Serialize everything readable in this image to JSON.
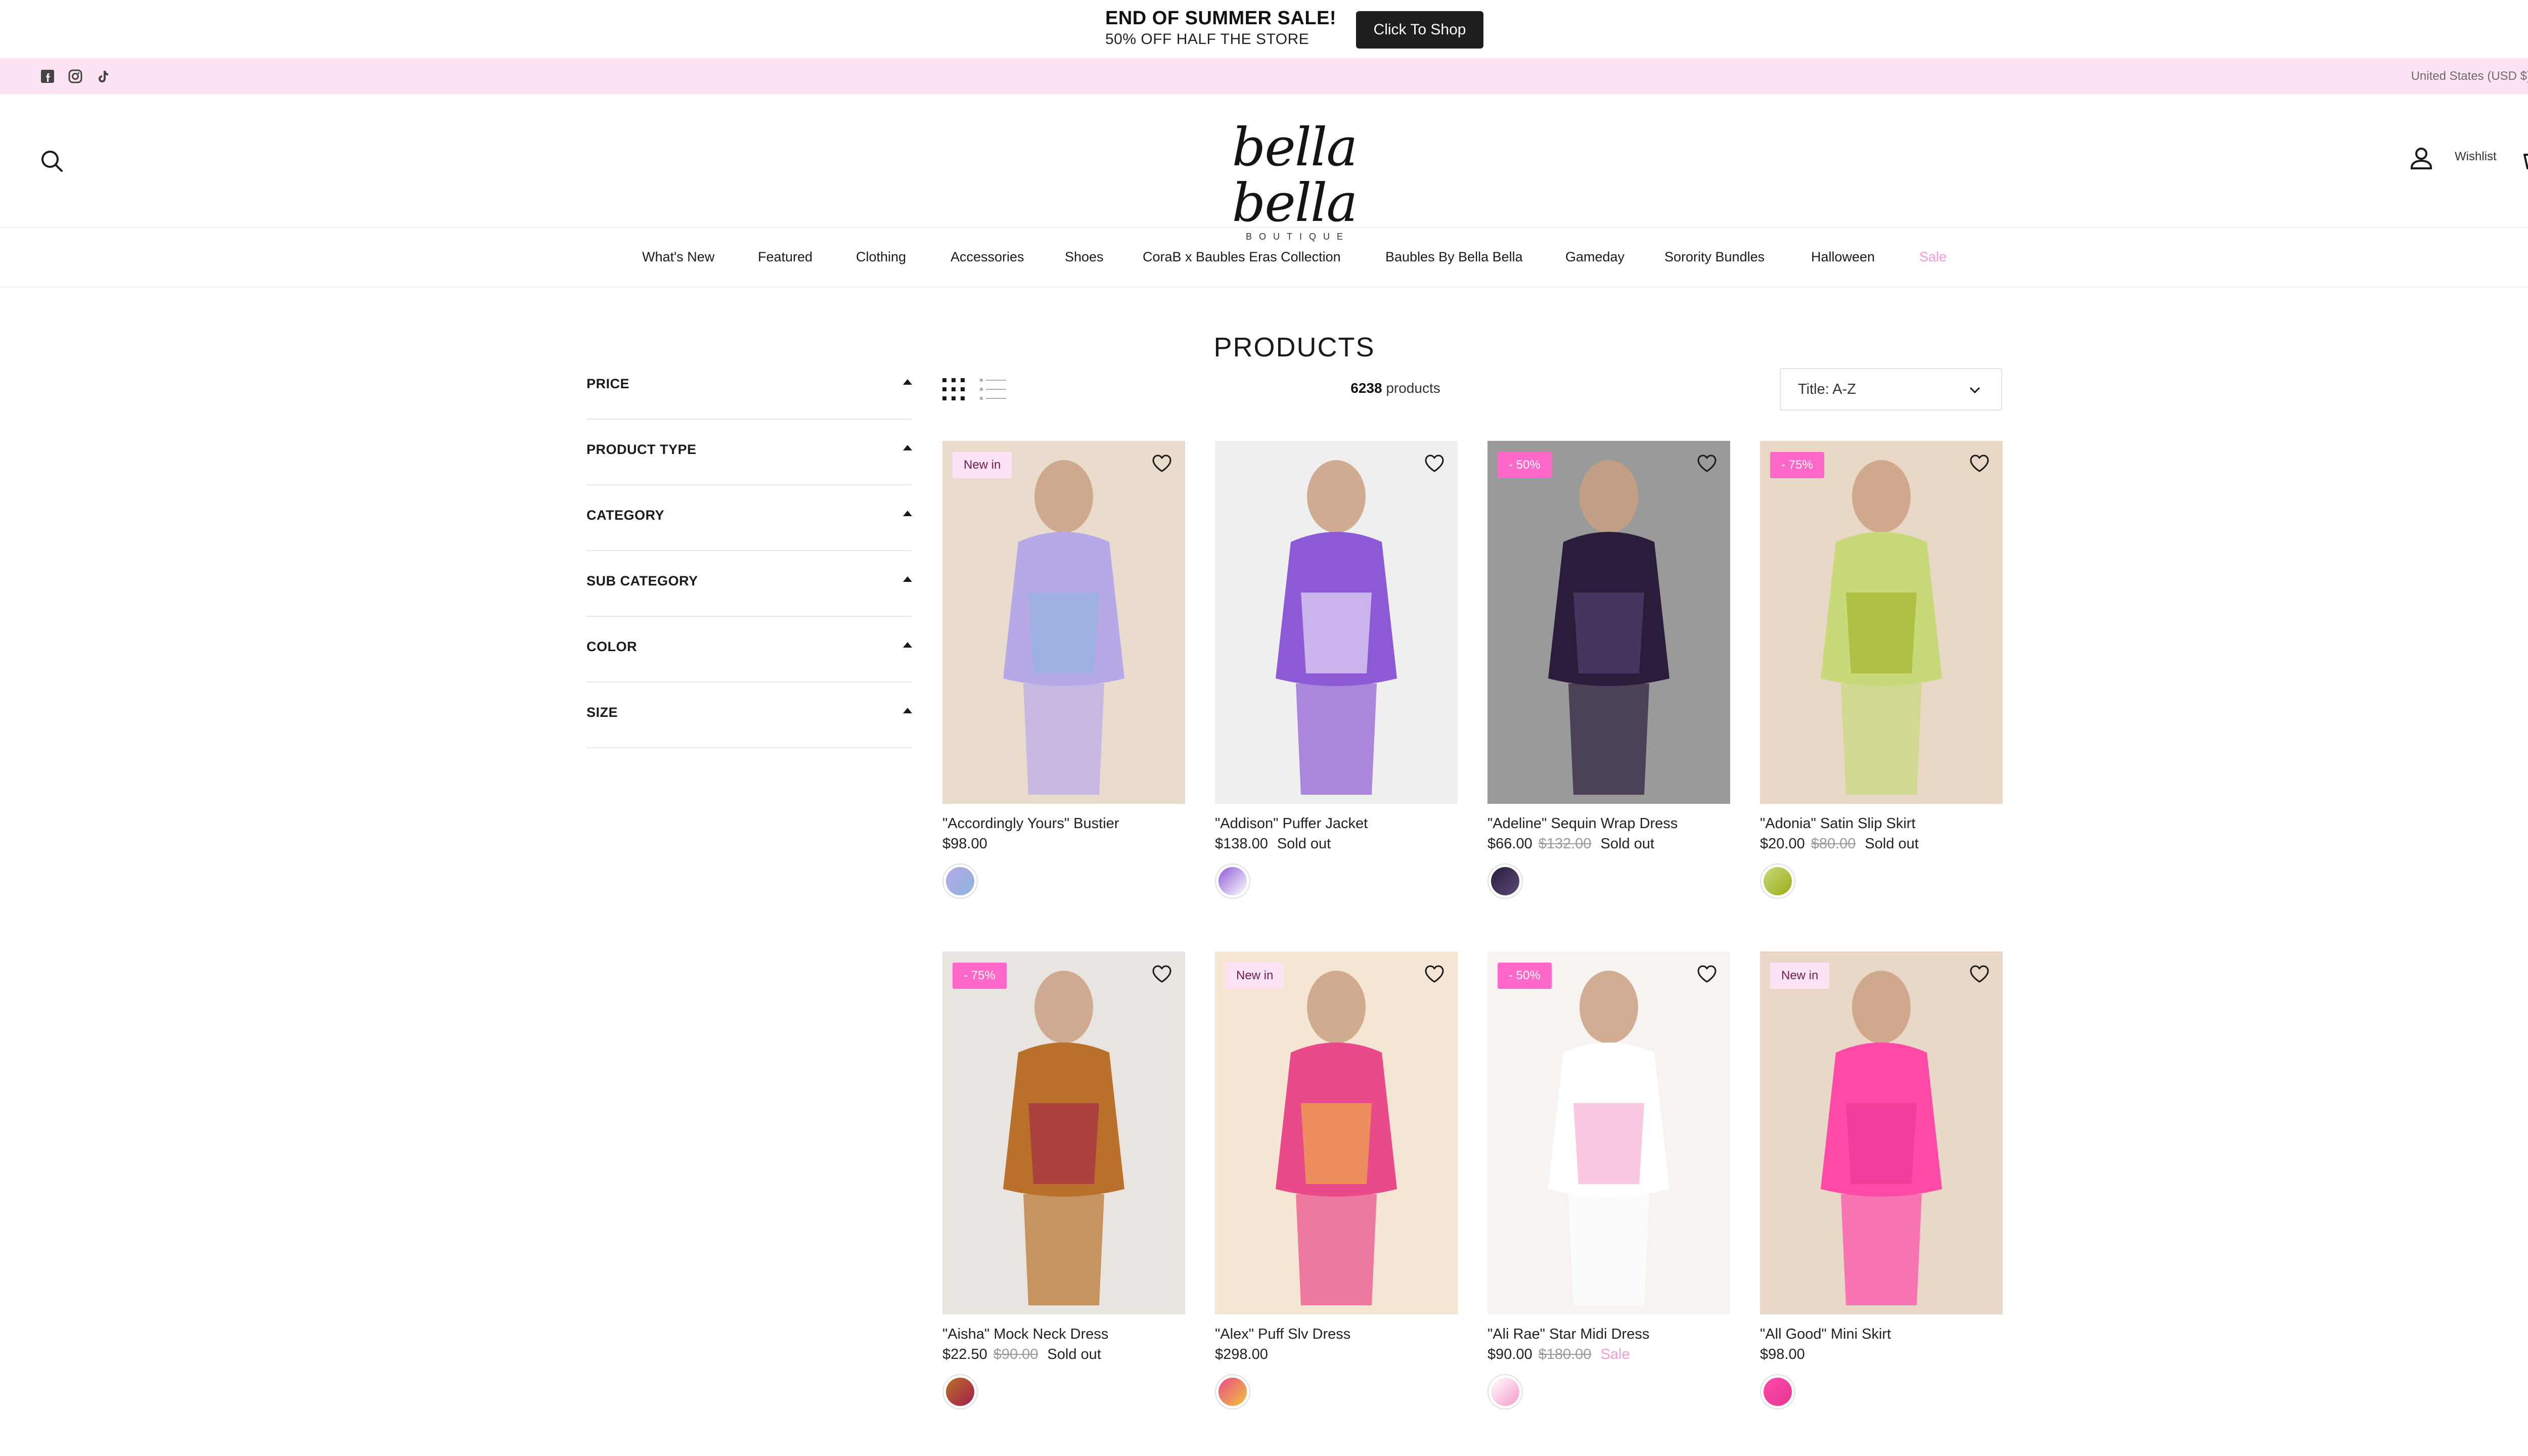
{
  "announcement": {
    "title": "END OF SUMMER SALE!",
    "subtitle": "50% OFF HALF THE STORE",
    "button": "Click To Shop"
  },
  "topbar": {
    "social_icons": [
      "facebook-icon",
      "instagram-icon",
      "tiktok-icon"
    ],
    "locale": "United States (USD $)"
  },
  "header": {
    "logo_script": "bella bella",
    "logo_sub": "BOUTIQUE",
    "wishlist": "Wishlist"
  },
  "nav": [
    {
      "label": "What's New"
    },
    {
      "label": "Featured"
    },
    {
      "label": "Clothing"
    },
    {
      "label": "Accessories"
    },
    {
      "label": "Shoes"
    },
    {
      "label": "CoraB x Baubles Eras Collection"
    },
    {
      "label": "Baubles By Bella Bella"
    },
    {
      "label": "Gameday"
    },
    {
      "label": "Sorority Bundles"
    },
    {
      "label": "Halloween"
    },
    {
      "label": "Sale"
    }
  ],
  "page_title": "PRODUCTS",
  "filters": [
    {
      "label": "PRICE"
    },
    {
      "label": "PRODUCT TYPE"
    },
    {
      "label": "CATEGORY"
    },
    {
      "label": "SUB CATEGORY"
    },
    {
      "label": "COLOR"
    },
    {
      "label": "SIZE"
    }
  ],
  "toolbar": {
    "count": "6238",
    "count_suffix": " products",
    "sort": "Title: A-Z"
  },
  "products": [
    {
      "name": "\"Accordingly Yours\" Bustier",
      "price": "$98.00",
      "compare": "",
      "status": "",
      "badge": "New in",
      "colors": [
        "#b7a8e8",
        "#8ab4dc",
        "#eadccd"
      ]
    },
    {
      "name": "\"Addison\" Puffer Jacket",
      "price": "$138.00",
      "compare": "",
      "status": "Sold out",
      "badge": "",
      "colors": [
        "#8d5ad6",
        "#ffffff",
        "#efefef"
      ]
    },
    {
      "name": "\"Adeline\" Sequin Wrap Dress",
      "price": "$66.00",
      "compare": "$132.00",
      "status": "Sold out",
      "badge": "- 50%",
      "colors": [
        "#2a1d3c",
        "#5a4a7a",
        "#9a9a9a"
      ]
    },
    {
      "name": "\"Adonia\" Satin Slip Skirt",
      "price": "$20.00",
      "compare": "$80.00",
      "status": "Sold out",
      "badge": "- 75%",
      "colors": [
        "#c8d97a",
        "#9cac1a",
        "#e8d8c5"
      ]
    },
    {
      "name": "\"Aisha\" Mock Neck Dress",
      "price": "$22.50",
      "compare": "$90.00",
      "status": "Sold out",
      "badge": "- 75%",
      "colors": [
        "#b9702a",
        "#a21d4c",
        "#e8e4e0"
      ]
    },
    {
      "name": "\"Alex\" Puff Slv Dress",
      "price": "$298.00",
      "compare": "",
      "status": "",
      "badge": "New in",
      "colors": [
        "#e94a8a",
        "#f2c43a",
        "#f5e6d3"
      ]
    },
    {
      "name": "\"Ali Rae\" Star Midi Dress",
      "price": "$90.00",
      "compare": "$180.00",
      "status": "Sale",
      "badge": "- 50%",
      "colors": [
        "#ffffff",
        "#f59ac8",
        "#f6f3f1"
      ]
    },
    {
      "name": "\"All Good\" Mini Skirt",
      "price": "$98.00",
      "compare": "",
      "status": "",
      "badge": "New in",
      "colors": [
        "#ff4aa8",
        "#e53593",
        "#e9d8c8"
      ]
    }
  ]
}
